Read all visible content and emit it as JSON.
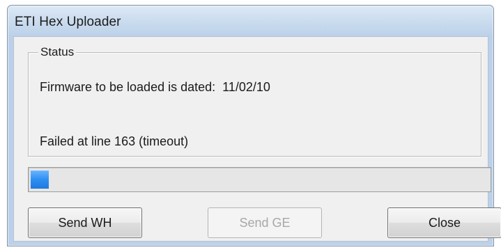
{
  "window": {
    "title": "ETI Hex Uploader"
  },
  "status_group": {
    "legend": "Status",
    "firmware_line": "Firmware to be loaded is dated:  11/02/10",
    "result_line": "Failed at line 163 (timeout)"
  },
  "progress": {
    "fraction": 0.04,
    "color": "#2d8ef2"
  },
  "buttons": {
    "send_wh": {
      "label": "Send WH",
      "enabled": true
    },
    "send_ge": {
      "label": "Send GE",
      "enabled": false
    },
    "close": {
      "label": "Close",
      "enabled": true
    }
  }
}
